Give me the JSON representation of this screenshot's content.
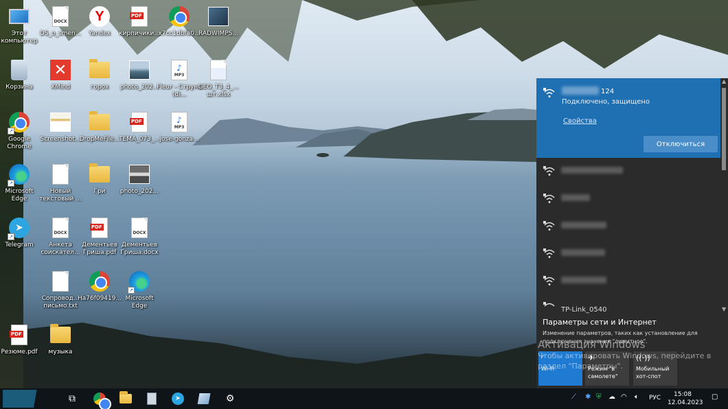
{
  "desktop": {
    "icons": [
      {
        "label": "Этот компьютер",
        "icon": "computer-icon"
      },
      {
        "label": "DS_o_smen...",
        "icon": "docx-file-icon"
      },
      {
        "label": "Yandex",
        "icon": "yandex-browser-icon"
      },
      {
        "label": "кирпичики...",
        "icon": "pdf-file-icon"
      },
      {
        "label": "x7cc1dbfa0...",
        "icon": "chrome-icon"
      },
      {
        "label": "RADWIMPS...",
        "icon": "video-file-icon"
      },
      {
        "label": "Корзина",
        "icon": "recycle-bin-icon"
      },
      {
        "label": "XMind",
        "icon": "xmind-icon"
      },
      {
        "label": "горох",
        "icon": "folder-icon"
      },
      {
        "label": "photo_202...",
        "icon": "photo-icon"
      },
      {
        "label": "Fleur - Струна (di...",
        "icon": "mp3-file-icon"
      },
      {
        "label": "GEO_T3_4_... шт.xlsx",
        "icon": "xlsx-file-icon"
      },
      {
        "label": "Google Chrome",
        "icon": "chrome-icon"
      },
      {
        "label": "Screenshot...",
        "icon": "screenshot-icon"
      },
      {
        "label": "DropMeFile...",
        "icon": "folder-icon"
      },
      {
        "label": "TEMA_073_...",
        "icon": "pdf-file-icon"
      },
      {
        "label": "jose-gonza...",
        "icon": "mp3-file-icon"
      },
      {
        "label": "Microsoft Edge",
        "icon": "edge-icon"
      },
      {
        "label": "Новый текстовый ...",
        "icon": "text-file-icon"
      },
      {
        "label": "Гри",
        "icon": "folder-icon"
      },
      {
        "label": "photo_202...",
        "icon": "photo-icon"
      },
      {
        "label": "Telegram",
        "icon": "telegram-icon"
      },
      {
        "label": "Анкета соискател...",
        "icon": "docx-file-icon"
      },
      {
        "label": "Дементьев Гриша.pdf",
        "icon": "pdf-file-icon"
      },
      {
        "label": "Дементьев Гриша.docx",
        "icon": "docx-file-icon"
      },
      {
        "label": "Сопровод... письмо.txt",
        "icon": "text-file-icon"
      },
      {
        "label": "Ha76f09419...",
        "icon": "chrome-icon"
      },
      {
        "label": "Microsoft Edge",
        "icon": "edge-icon"
      },
      {
        "label": "Резюме.pdf",
        "icon": "pdf-file-icon"
      },
      {
        "label": "музыка",
        "icon": "folder-icon"
      }
    ],
    "file_badges": {
      "docx": "DOCX",
      "pdf": "PDF",
      "mp3": "MP3"
    }
  },
  "network_flyout": {
    "connected": {
      "name_suffix": "124",
      "status": "Подключено, защищено",
      "properties_link": "Свойства",
      "disconnect_button": "Отключиться"
    },
    "partial_network_name": "TP-Link_0540",
    "settings_title": "Параметры сети и Интернет",
    "settings_desc": "Изменение параметров, таких как установление для подключения значения \"лимитное\".",
    "tiles": {
      "wifi": "Wi-Fi",
      "airplane": "Режим \"в самолете\"",
      "hotspot": "Мобильный хот-спот"
    }
  },
  "watermark": {
    "title": "Активация Windows",
    "text": "Чтобы активировать Windows, перейдите в раздел \"Параметры\"."
  },
  "taskbar": {
    "language": "РУС",
    "time": "15:08",
    "date": "12.04.2023"
  }
}
